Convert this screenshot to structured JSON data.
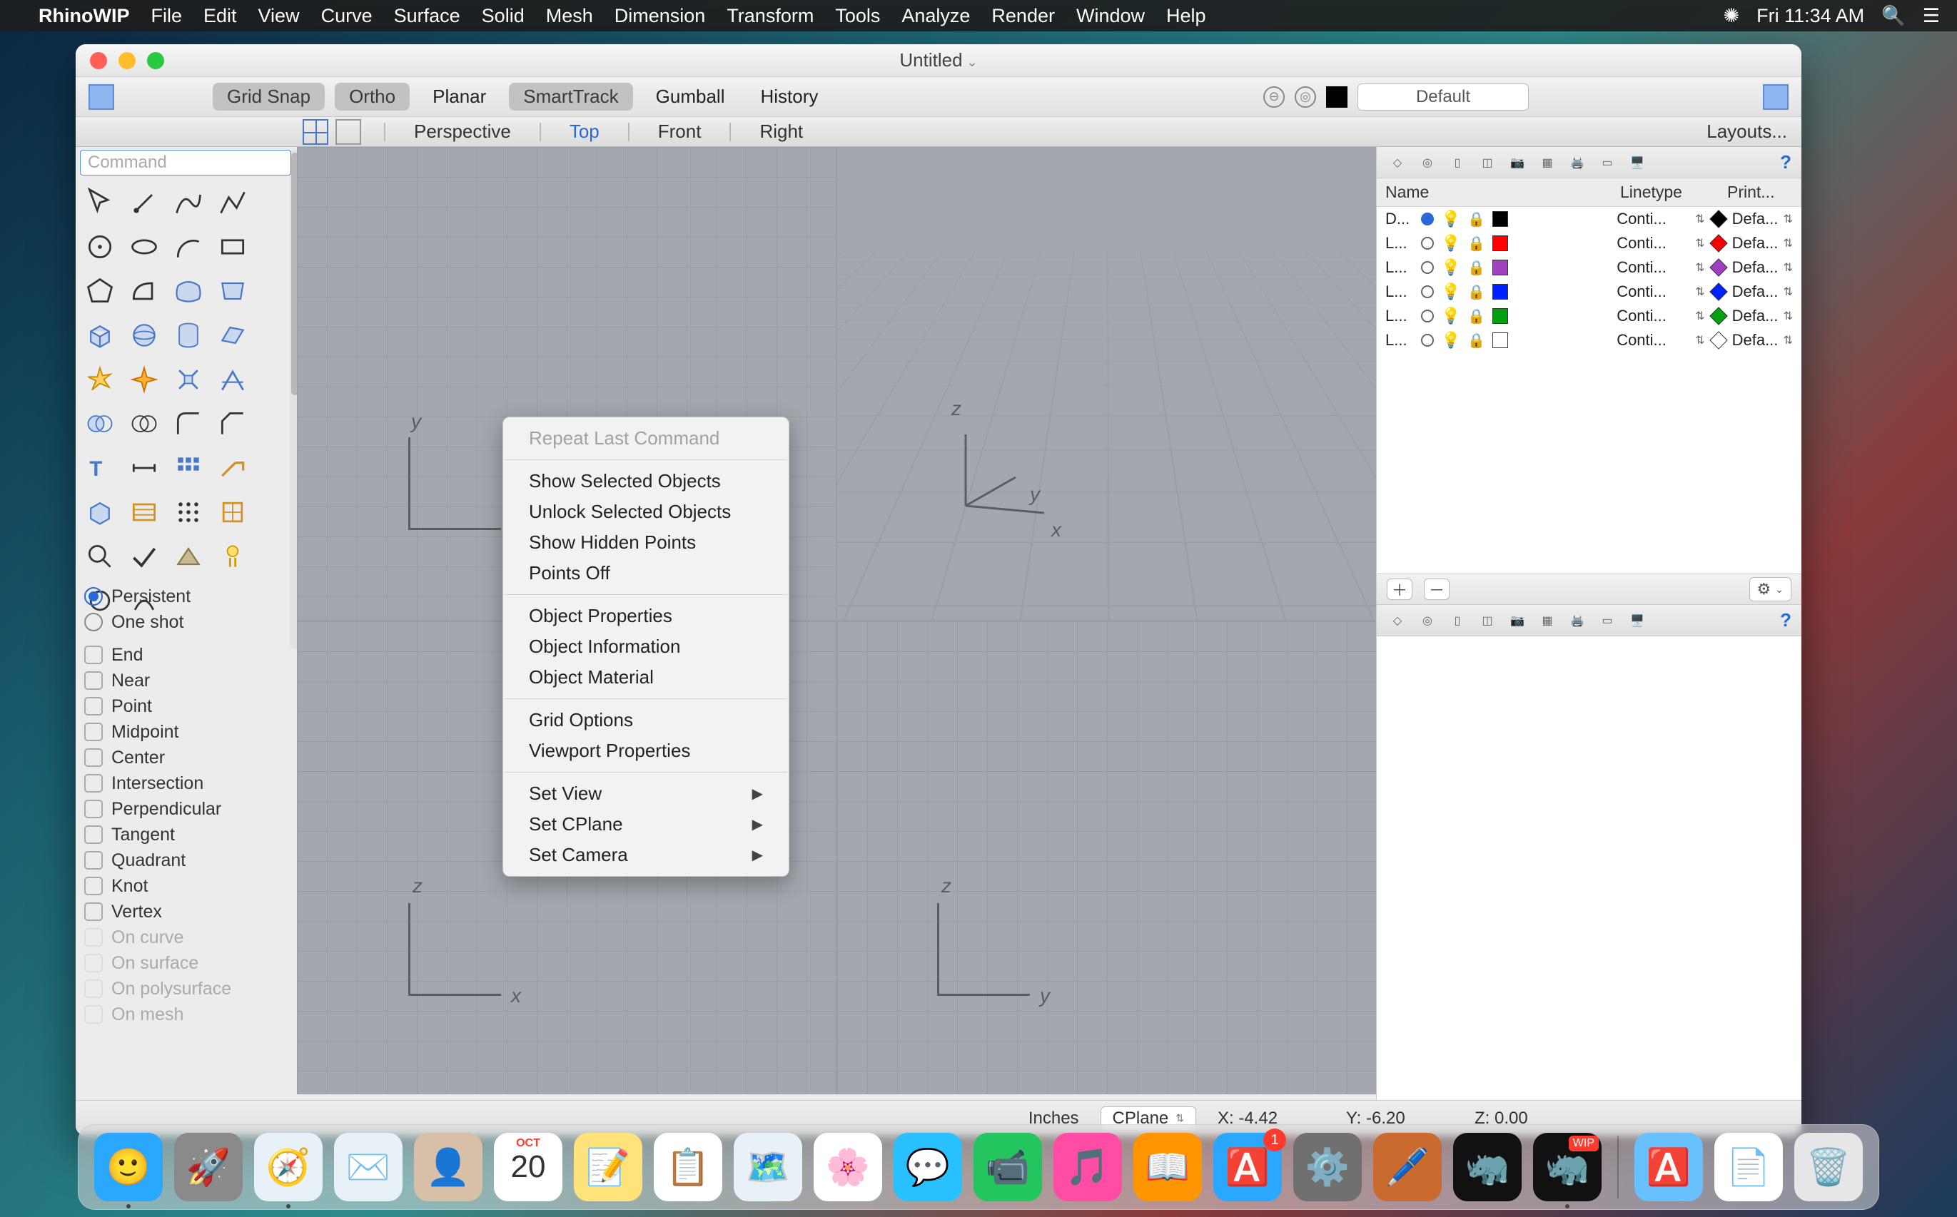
{
  "menubar": {
    "app": "RhinoWIP",
    "items": [
      "File",
      "Edit",
      "View",
      "Curve",
      "Surface",
      "Solid",
      "Mesh",
      "Dimension",
      "Transform",
      "Tools",
      "Analyze",
      "Render",
      "Window",
      "Help"
    ],
    "clock": "Fri 11:34 AM"
  },
  "window": {
    "title": "Untitled"
  },
  "toolbar": {
    "grid_snap": "Grid Snap",
    "ortho": "Ortho",
    "planar": "Planar",
    "smarttrack": "SmartTrack",
    "gumball": "Gumball",
    "history": "History",
    "layer_default": "Default"
  },
  "viewtabs": {
    "tabs": [
      "Perspective",
      "Top",
      "Front",
      "Right"
    ],
    "active": 1,
    "layouts": "Layouts..."
  },
  "command_placeholder": "Command",
  "osnap": {
    "modes": [
      "Persistent",
      "One shot"
    ],
    "mode_selected": 0,
    "snaps": [
      {
        "label": "End",
        "enabled": true
      },
      {
        "label": "Near",
        "enabled": true
      },
      {
        "label": "Point",
        "enabled": true
      },
      {
        "label": "Midpoint",
        "enabled": true
      },
      {
        "label": "Center",
        "enabled": true
      },
      {
        "label": "Intersection",
        "enabled": true
      },
      {
        "label": "Perpendicular",
        "enabled": true
      },
      {
        "label": "Tangent",
        "enabled": true
      },
      {
        "label": "Quadrant",
        "enabled": true
      },
      {
        "label": "Knot",
        "enabled": true
      },
      {
        "label": "Vertex",
        "enabled": true
      },
      {
        "label": "On curve",
        "enabled": false
      },
      {
        "label": "On surface",
        "enabled": false
      },
      {
        "label": "On polysurface",
        "enabled": false
      },
      {
        "label": "On mesh",
        "enabled": false
      }
    ]
  },
  "context_menu": {
    "items": [
      {
        "label": "Repeat Last Command",
        "disabled": true
      },
      {
        "sep": true
      },
      {
        "label": "Show Selected Objects"
      },
      {
        "label": "Unlock Selected Objects"
      },
      {
        "label": "Show Hidden Points"
      },
      {
        "label": "Points Off"
      },
      {
        "sep": true
      },
      {
        "label": "Object Properties"
      },
      {
        "label": "Object Information"
      },
      {
        "label": "Object Material"
      },
      {
        "sep": true
      },
      {
        "label": "Grid Options"
      },
      {
        "label": "Viewport Properties"
      },
      {
        "sep": true
      },
      {
        "label": "Set View",
        "submenu": true
      },
      {
        "label": "Set CPlane",
        "submenu": true
      },
      {
        "label": "Set Camera",
        "submenu": true
      }
    ]
  },
  "layers": {
    "headers": {
      "name": "Name",
      "linetype": "Linetype",
      "print": "Print..."
    },
    "rows": [
      {
        "name": "D...",
        "current": true,
        "color": "#000000",
        "diam": "#000000",
        "linetype": "Conti...",
        "print": "Defa..."
      },
      {
        "name": "L...",
        "current": false,
        "color": "#ff0000",
        "diam": "#ff0000",
        "linetype": "Conti...",
        "print": "Defa..."
      },
      {
        "name": "L...",
        "current": false,
        "color": "#a040c0",
        "diam": "#a040c0",
        "linetype": "Conti...",
        "print": "Defa..."
      },
      {
        "name": "L...",
        "current": false,
        "color": "#0020ff",
        "diam": "#0020ff",
        "linetype": "Conti...",
        "print": "Defa..."
      },
      {
        "name": "L...",
        "current": false,
        "color": "#00a010",
        "diam": "#00a010",
        "linetype": "Conti...",
        "print": "Defa..."
      },
      {
        "name": "L...",
        "current": false,
        "color": "#ffffff",
        "diam": "#ffffff",
        "linetype": "Conti...",
        "print": "Defa..."
      }
    ]
  },
  "status": {
    "units": "Inches",
    "cplane": "CPlane",
    "x": "X: -4.42",
    "y": "Y: -6.20",
    "z": "Z: 0.00"
  },
  "dock": {
    "apps": [
      {
        "name": "finder",
        "bg": "#2aa8ff",
        "emoji": "🙂",
        "running": true
      },
      {
        "name": "launchpad",
        "bg": "#8a8a8a",
        "emoji": "🚀"
      },
      {
        "name": "safari",
        "bg": "#e8f0f8",
        "emoji": "🧭",
        "running": true
      },
      {
        "name": "mail",
        "bg": "#e8f0f8",
        "emoji": "✉️"
      },
      {
        "name": "contacts",
        "bg": "#d8bfa8",
        "emoji": "👤"
      },
      {
        "name": "calendar",
        "bg": "#ffffff",
        "emoji": "📅",
        "text_top": "OCT",
        "text_main": "20"
      },
      {
        "name": "notes",
        "bg": "#ffe27a",
        "emoji": "📝"
      },
      {
        "name": "reminders",
        "bg": "#ffffff",
        "emoji": "📋"
      },
      {
        "name": "maps",
        "bg": "#e8f0f8",
        "emoji": "🗺️"
      },
      {
        "name": "photos",
        "bg": "#ffffff",
        "emoji": "🌸"
      },
      {
        "name": "messages",
        "bg": "#29c0ff",
        "emoji": "💬"
      },
      {
        "name": "facetime",
        "bg": "#22c55e",
        "emoji": "📹"
      },
      {
        "name": "itunes",
        "bg": "#ff4da6",
        "emoji": "🎵"
      },
      {
        "name": "ibooks",
        "bg": "#ff9500",
        "emoji": "📖"
      },
      {
        "name": "appstore",
        "bg": "#2aa8ff",
        "emoji": "🅰️",
        "badge": "1"
      },
      {
        "name": "preferences",
        "bg": "#707070",
        "emoji": "⚙️"
      },
      {
        "name": "app1",
        "bg": "#c96a2e",
        "emoji": "🖊️"
      },
      {
        "name": "app2",
        "bg": "#111111",
        "emoji": "🦏"
      },
      {
        "name": "rhinowip",
        "bg": "#111111",
        "emoji": "🦏",
        "running": true,
        "wip": "WIP"
      }
    ],
    "right": [
      {
        "name": "applications-folder",
        "bg": "#68c0ff",
        "emoji": "🅰️"
      },
      {
        "name": "document",
        "bg": "#ffffff",
        "emoji": "📄"
      },
      {
        "name": "trash",
        "bg": "#e6e6e6",
        "emoji": "🗑️"
      }
    ]
  },
  "axes": {
    "x": "x",
    "y": "y",
    "z": "z"
  }
}
